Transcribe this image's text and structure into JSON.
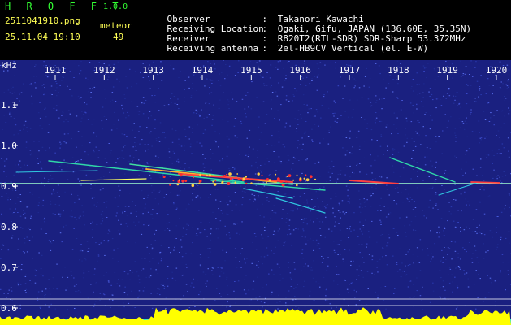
{
  "header": {
    "app_title": "H R O F F T",
    "app_version": "1.0.0",
    "file_name": "2511041910.png",
    "mode": "meteor",
    "timestamp": "25.11.04 19:10",
    "count": "49"
  },
  "info": [
    {
      "label": "Observer",
      "value": "Takanori Kawachi"
    },
    {
      "label": "Receiving Location",
      "value": "Ogaki, Gifu, JAPAN (136.60E, 35.35N)"
    },
    {
      "label": "Receiver",
      "value": "R820T2(RTL-SDR) SDR-Sharp 53.372MHz"
    },
    {
      "label": "Receiving antenna",
      "value": "2el-HB9CV Vertical (el. E-W)"
    }
  ],
  "axis": {
    "unit": "kHz",
    "time_labels": [
      "1911",
      "1912",
      "1913",
      "1914",
      "1915",
      "1916",
      "1917",
      "1918",
      "1919",
      "1920"
    ],
    "freq_labels": [
      "1.1",
      "1.0",
      "0.9",
      "0.8",
      "0.7",
      "0.6"
    ]
  },
  "colors": {
    "background": "#1a2080",
    "carrier": "#a0ffd0",
    "trace": "#30d8a8",
    "hot": "#ff3030",
    "signal_bar": "#ffff00",
    "baseline": "#00e0ff"
  }
}
